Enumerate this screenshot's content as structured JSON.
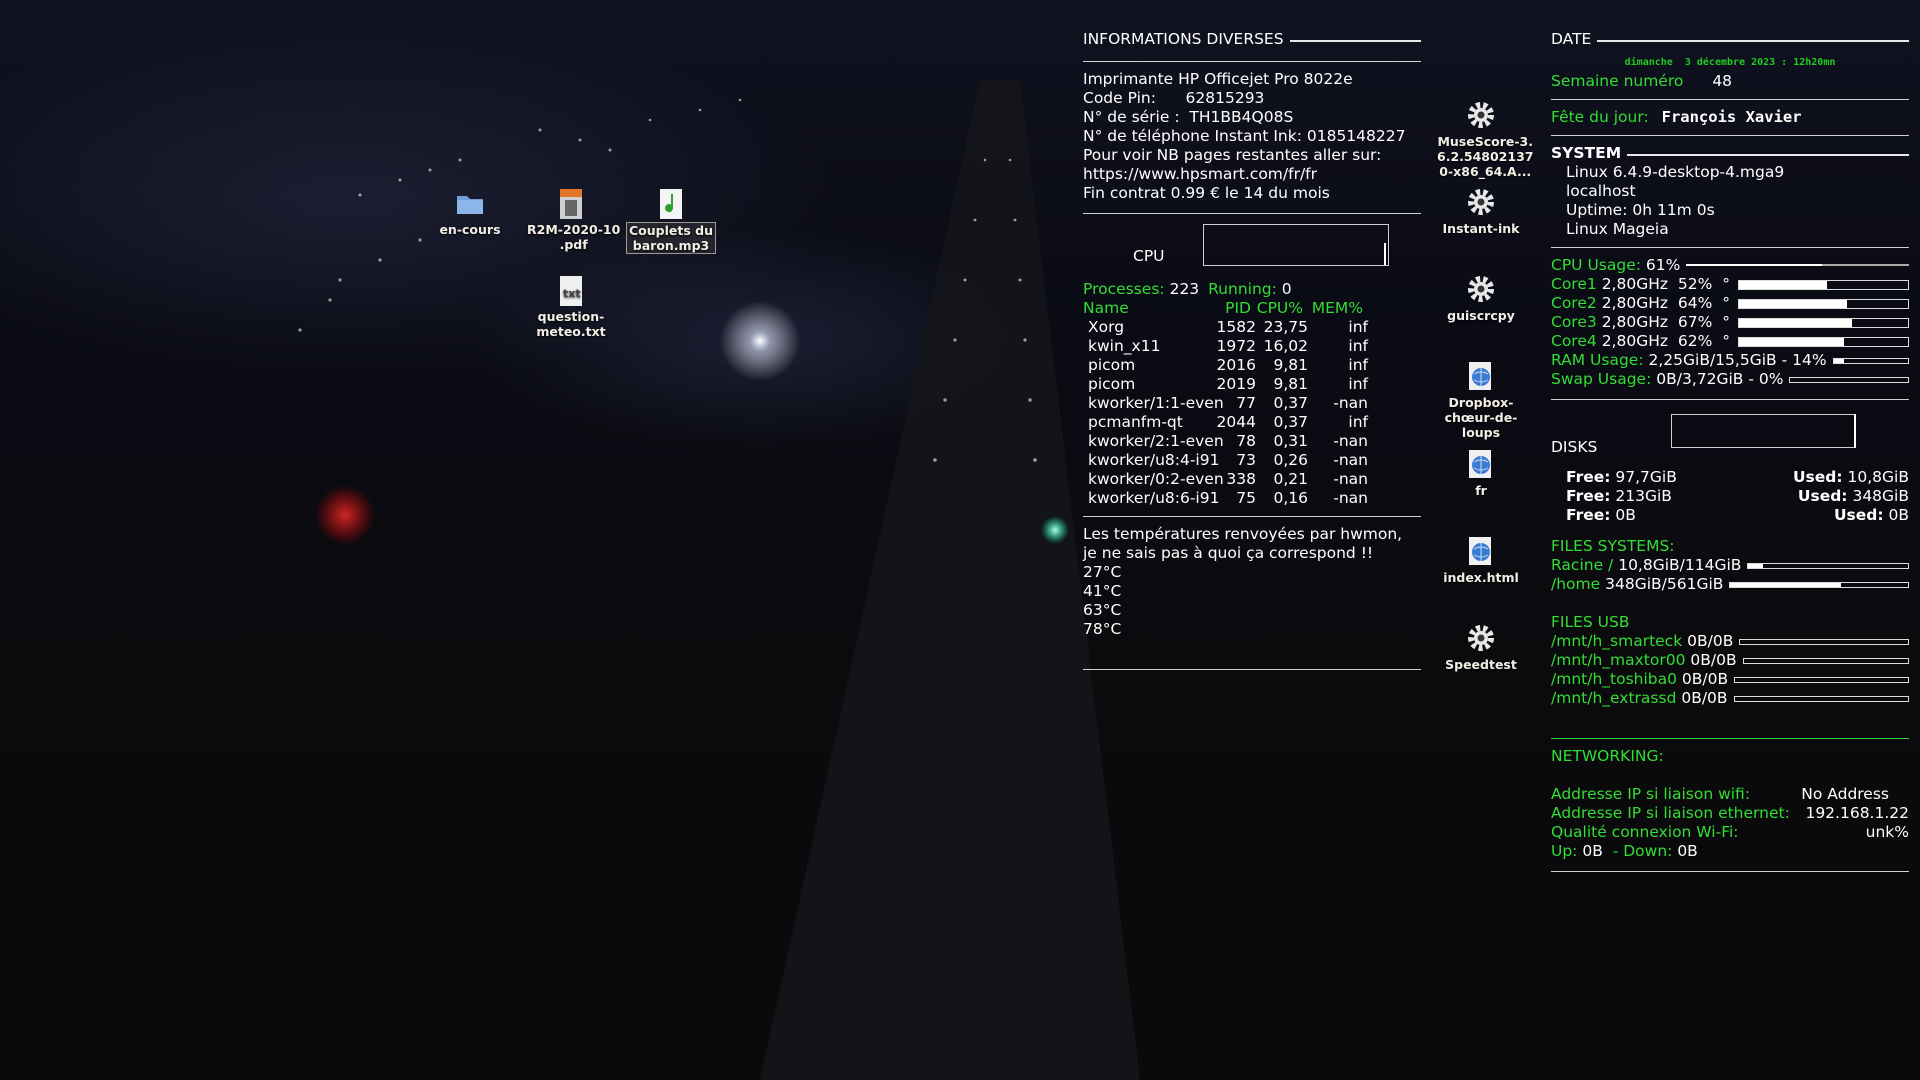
{
  "desktop": {
    "icons": [
      {
        "label": "en-cours",
        "icon": "folder-icon"
      },
      {
        "label": "R2M-2020-10\n.pdf",
        "icon": "pdf-file-icon"
      },
      {
        "label": "Couplets du\nbaron.mp3",
        "icon": "audio-file-icon"
      },
      {
        "label": "question-\nmeteo.txt",
        "icon": "text-file-icon"
      }
    ],
    "launchers": [
      {
        "label": "MuseScore-3.\n6.2.54802137\n0-x86_64.A...",
        "icon": "gear-icon"
      },
      {
        "label": "Instant-ink",
        "icon": "gear-icon"
      },
      {
        "label": "guiscrcpy",
        "icon": "gear-icon"
      },
      {
        "label": "Dropbox-\nchœur-de-\nloups",
        "icon": "globe-icon"
      },
      {
        "label": "fr",
        "icon": "globe-icon"
      },
      {
        "label": "index.html",
        "icon": "globe-icon"
      },
      {
        "label": "Speedtest",
        "icon": "gear-icon"
      }
    ]
  },
  "info": {
    "title": "INFORMATIONS DIVERSES",
    "lines": [
      "Imprimante HP Officejet Pro 8022e",
      "Code Pin:      62815293",
      "N° de série :  TH1BB4Q08S",
      "N° de téléphone Instant Ink: 0185148227",
      "Pour voir NB pages restantes aller sur:",
      "https://www.hpsmart.com/fr/fr",
      "Fin contrat 0.99 € le 14 du mois"
    ],
    "cpu_label": "CPU",
    "processes_label": "Processes:",
    "processes_value": "223",
    "running_label": "Running:",
    "running_value": "0",
    "proc_headers": [
      "Name",
      "PID",
      "CPU%",
      "MEM%"
    ],
    "procs": [
      [
        "Xorg",
        "1582",
        "23,75",
        "inf"
      ],
      [
        "kwin_x11",
        "1972",
        "16,02",
        "inf"
      ],
      [
        "picom",
        "2016",
        "9,81",
        "inf"
      ],
      [
        "picom",
        "2019",
        "9,81",
        "inf"
      ],
      [
        "kworker/1:1-even",
        "77",
        "0,37",
        "-nan"
      ],
      [
        "pcmanfm-qt",
        "2044",
        "0,37",
        "inf"
      ],
      [
        "kworker/2:1-even",
        "78",
        "0,31",
        "-nan"
      ],
      [
        "kworker/u8:4-i91",
        "73",
        "0,26",
        "-nan"
      ],
      [
        "kworker/0:2-even",
        "338",
        "0,21",
        "-nan"
      ],
      [
        "kworker/u8:6-i91",
        "75",
        "0,16",
        "-nan"
      ]
    ],
    "temp_note_1": "Les températures renvoyées par hwmon,",
    "temp_note_2": "je ne sais pas à quoi ça correspond !!",
    "temps": [
      "27°C",
      "41°C",
      "63°C",
      "78°C"
    ]
  },
  "right": {
    "date_title": "DATE",
    "date_value": "dimanche  3 décembre 2023 : 12h20mn",
    "week_label": "Semaine numéro",
    "week_value": "48",
    "feast_label": "Fête du jour:",
    "feast_value": "François Xavier",
    "system_title": "SYSTEM",
    "system_lines": [
      "Linux 6.4.9-desktop-4.mga9",
      "localhost",
      "Uptime: 0h 11m 0s",
      "Linux Mageia"
    ],
    "cpu_usage_label": "CPU Usage:",
    "cpu_usage_value": "61%",
    "cpu_usage_fraction": 0.61,
    "cores": [
      {
        "label": "Core1",
        "freq": "2,80GHz",
        "pct": "52%",
        "deg": "°",
        "fraction": 0.52
      },
      {
        "label": "Core2",
        "freq": "2,80GHz",
        "pct": "64%",
        "deg": "°",
        "fraction": 0.64
      },
      {
        "label": "Core3",
        "freq": "2,80GHz",
        "pct": "67%",
        "deg": "°",
        "fraction": 0.67
      },
      {
        "label": "Core4",
        "freq": "2,80GHz",
        "pct": "62%",
        "deg": "°",
        "fraction": 0.62
      }
    ],
    "ram_label": "RAM Usage:",
    "ram_value": "2,25GiB/15,5GiB - 14%",
    "ram_fraction": 0.14,
    "swap_label": "Swap Usage:",
    "swap_value": "0B/3,72GiB - 0%",
    "swap_fraction": 0.0,
    "disks_title": "DISKS",
    "disks": [
      {
        "free_label": "Free:",
        "free": "97,7GiB",
        "used_label": "Used:",
        "used": "10,8GiB"
      },
      {
        "free_label": "Free:",
        "free": "213GiB",
        "used_label": "Used:",
        "used": "348GiB"
      },
      {
        "free_label": "Free:",
        "free": "0B",
        "used_label": "Used:",
        "used": "0B"
      }
    ],
    "fs_title": "FILES SYSTEMS:",
    "fs": [
      {
        "label": "Racine /",
        "value": "10,8GiB/114GiB",
        "fraction": 0.09
      },
      {
        "label": "/home",
        "value": "348GiB/561GiB",
        "fraction": 0.62
      }
    ],
    "usb_title": "FILES USB",
    "usb": [
      {
        "label": "/mnt/h_smarteck",
        "value": "0B/0B",
        "fraction": 0
      },
      {
        "label": "/mnt/h_maxtor00",
        "value": "0B/0B",
        "fraction": 0
      },
      {
        "label": "/mnt/h_toshiba0",
        "value": "0B/0B",
        "fraction": 0
      },
      {
        "label": "/mnt/h_extrassd",
        "value": "0B/0B",
        "fraction": 0
      }
    ],
    "net_title": "NETWORKING:",
    "wifi_ip_label": "Addresse IP si liaison wifi:",
    "wifi_ip_value": "No Address",
    "eth_ip_label": "Addresse IP si liaison ethernet:",
    "eth_ip_value": "192.168.1.22",
    "wifi_quality_label": "Qualité connexion Wi-Fi:",
    "wifi_quality_value": "unk%",
    "up_label": "Up:",
    "up_value": "0B",
    "down_label": "- Down:",
    "down_value": "0B"
  },
  "colors": {
    "accent_green": "#33dd33",
    "text": "#ffffff",
    "date_green": "#22cc22"
  }
}
